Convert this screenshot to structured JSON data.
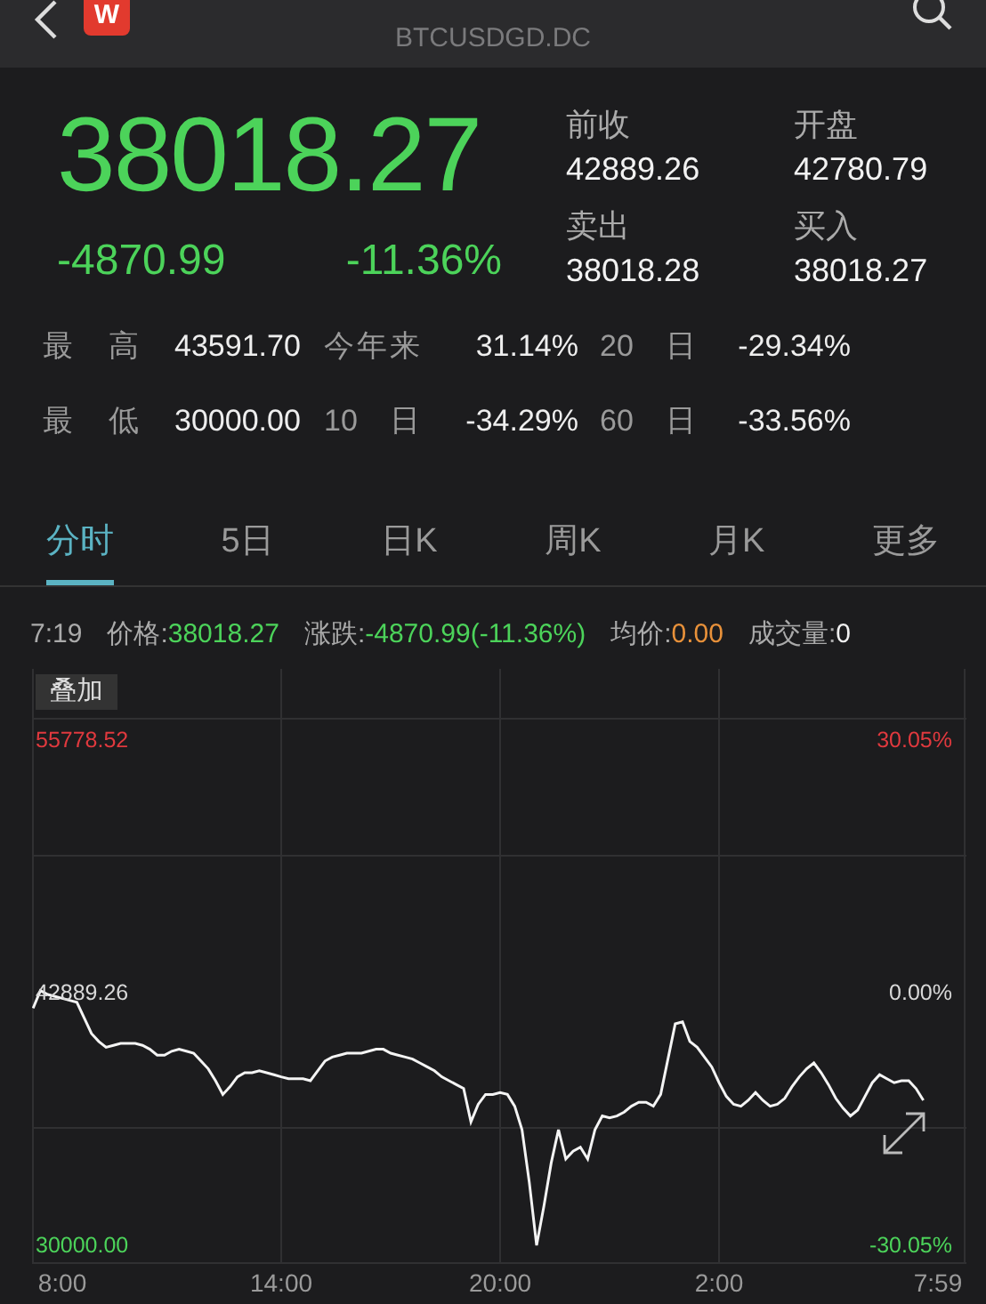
{
  "header": {
    "logo_text": "W",
    "subtitle": "BTCUSDGD.DC"
  },
  "quote": {
    "price": "38018.27",
    "change": "-4870.99",
    "change_pct": "-11.36%"
  },
  "quote_fields": [
    {
      "label": "前收",
      "value": "42889.26"
    },
    {
      "label": "开盘",
      "value": "42780.79"
    },
    {
      "label": "卖出",
      "value": "38018.28"
    },
    {
      "label": "买入",
      "value": "38018.27"
    }
  ],
  "stats": [
    {
      "label": "最 高",
      "value": "43591.70"
    },
    {
      "label": "今年来",
      "value": "31.14%"
    },
    {
      "label": "20 日",
      "value": "-29.34%"
    },
    {
      "label": "最 低",
      "value": "30000.00"
    },
    {
      "label": "10 日",
      "value": "-34.29%"
    },
    {
      "label": "60 日",
      "value": "-33.56%"
    }
  ],
  "tabs": [
    {
      "label": "分时",
      "selected": true
    },
    {
      "label": "5日",
      "selected": false
    },
    {
      "label": "日K",
      "selected": false
    },
    {
      "label": "周K",
      "selected": false
    },
    {
      "label": "月K",
      "selected": false
    },
    {
      "label": "更多",
      "selected": false
    }
  ],
  "info_bar": {
    "time": "7:19",
    "items": [
      {
        "label": "价格:",
        "value": "38018.27",
        "color": "#4cd35a"
      },
      {
        "label": "涨跌:",
        "value": "-4870.99(-11.36%)",
        "color": "#4cd35a"
      },
      {
        "label": "均价:",
        "value": "0.00",
        "color": "#e8913a"
      },
      {
        "label": "成交量:",
        "value": "0",
        "color": "#f0f0f0"
      }
    ]
  },
  "chart": {
    "overlay_button": "叠加",
    "percent_labels": [
      {
        "label": "30.05%",
        "color": "#e0393e"
      },
      {
        "label": "0.00%",
        "color": "#d8d8d8"
      },
      {
        "label": "-30.05%",
        "color": "#4cd35a"
      }
    ],
    "chart_data": {
      "type": "line",
      "categories": [
        null,
        null,
        null,
        null,
        "8:00",
        null,
        null,
        null,
        null,
        null,
        null,
        null,
        null,
        null,
        null,
        null,
        null,
        null,
        null,
        null,
        null,
        null,
        null,
        null,
        null,
        null,
        null,
        null,
        null,
        null,
        null,
        null,
        null,
        null,
        "14:00",
        null,
        null,
        null,
        null,
        null,
        null,
        null,
        null,
        null,
        null,
        null,
        null,
        null,
        null,
        null,
        null,
        null,
        null,
        null,
        null,
        null,
        null,
        null,
        null,
        null,
        null,
        null,
        null,
        null,
        "20:00",
        null,
        null,
        null,
        null,
        null,
        null,
        null,
        null,
        null,
        null,
        null,
        null,
        null,
        null,
        null,
        null,
        null,
        null,
        null,
        null,
        null,
        null,
        null,
        null,
        null,
        null,
        null,
        null,
        null,
        "2:00",
        null,
        null,
        null,
        null,
        null,
        null,
        null,
        null,
        null,
        null,
        null,
        null,
        null,
        null,
        null,
        null,
        null,
        null,
        null,
        null,
        null,
        null,
        null,
        null,
        null,
        null,
        null,
        null,
        null,
        "7:59"
      ],
      "series": [
        {
          "color": "#f4f4f4",
          "values": [
            42100,
            43000,
            42800,
            42700,
            42600,
            42500,
            42400,
            41600,
            40800,
            40400,
            40100,
            40200,
            40300,
            40300,
            40300,
            40200,
            40000,
            39700,
            39700,
            39900,
            40000,
            39900,
            39800,
            39400,
            39000,
            38400,
            37700,
            38100,
            38600,
            38800,
            38800,
            38900,
            38800,
            38700,
            38600,
            38500,
            38500,
            38500,
            38400,
            38900,
            39400,
            39600,
            39700,
            39800,
            39800,
            39800,
            39900,
            40000,
            40000,
            39800,
            39700,
            39600,
            39500,
            39300,
            39100,
            38900,
            38600,
            38400,
            38200,
            38000,
            36300,
            37200,
            37700,
            37700,
            37800,
            37700,
            37100,
            35900,
            33200,
            30000,
            32000,
            34200,
            35900,
            34400,
            34800,
            35000,
            34400,
            35900,
            36600,
            36500,
            36600,
            36800,
            37100,
            37300,
            37300,
            37100,
            37700,
            39500,
            41300,
            41400,
            40400,
            40100,
            39600,
            39100,
            38300,
            37600,
            37200,
            37100,
            37400,
            37800,
            37400,
            37100,
            37200,
            37500,
            38100,
            38600,
            39000,
            39300,
            38800,
            38200,
            37500,
            37000,
            36600,
            36900,
            37600,
            38300,
            38700,
            38500,
            38300,
            38400,
            38400,
            38000,
            37400,
            null,
            null
          ]
        }
      ],
      "ylim": [
        29092,
        59409
      ],
      "yticks": [
        {
          "value": 55778.52,
          "label": "55778.52"
        },
        {
          "value": 42889.26,
          "label": "42889.26"
        },
        {
          "value": 30000,
          "label": "30000.00"
        }
      ]
    }
  }
}
